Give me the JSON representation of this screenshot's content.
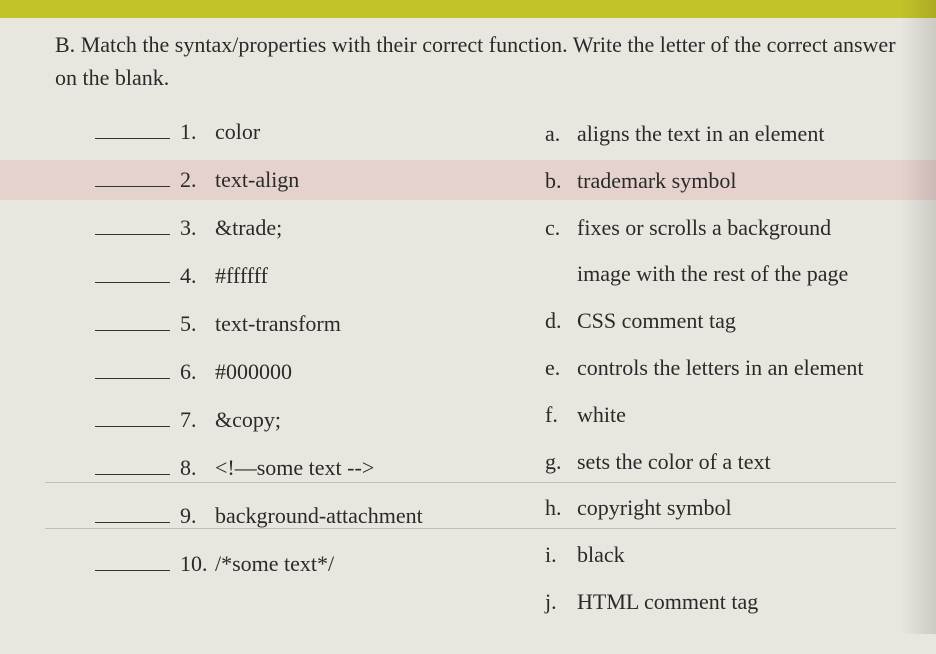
{
  "instruction": {
    "prefix": "B.",
    "text": "Match the syntax/properties with their correct function. Write the letter of the correct answer on the blank."
  },
  "questions": [
    {
      "num": "1.",
      "text": "color"
    },
    {
      "num": "2.",
      "text": "text-align"
    },
    {
      "num": "3.",
      "text": "&trade;"
    },
    {
      "num": "4.",
      "text": "#ffffff"
    },
    {
      "num": "5.",
      "text": "text-transform"
    },
    {
      "num": "6.",
      "text": "#000000"
    },
    {
      "num": "7.",
      "text": "&copy;"
    },
    {
      "num": "8.",
      "text": "<!—some text -->"
    },
    {
      "num": "9.",
      "text": "background-attachment"
    },
    {
      "num": "10.",
      "text": "/*some text*/"
    }
  ],
  "answers": [
    {
      "letter": "a.",
      "text": "aligns the text in an element"
    },
    {
      "letter": "b.",
      "text": "trademark symbol"
    },
    {
      "letter": "c.",
      "text": "fixes or scrolls a background"
    },
    {
      "letter": "",
      "text": "image with the rest of the page"
    },
    {
      "letter": "d.",
      "text": "CSS comment tag"
    },
    {
      "letter": "e.",
      "text": "controls the letters in an element"
    },
    {
      "letter": "f.",
      "text": "white"
    },
    {
      "letter": "g.",
      "text": "sets the color of a text"
    },
    {
      "letter": "h.",
      "text": "copyright symbol"
    },
    {
      "letter": "i.",
      "text": "black"
    },
    {
      "letter": "j.",
      "text": "HTML comment tag"
    }
  ]
}
